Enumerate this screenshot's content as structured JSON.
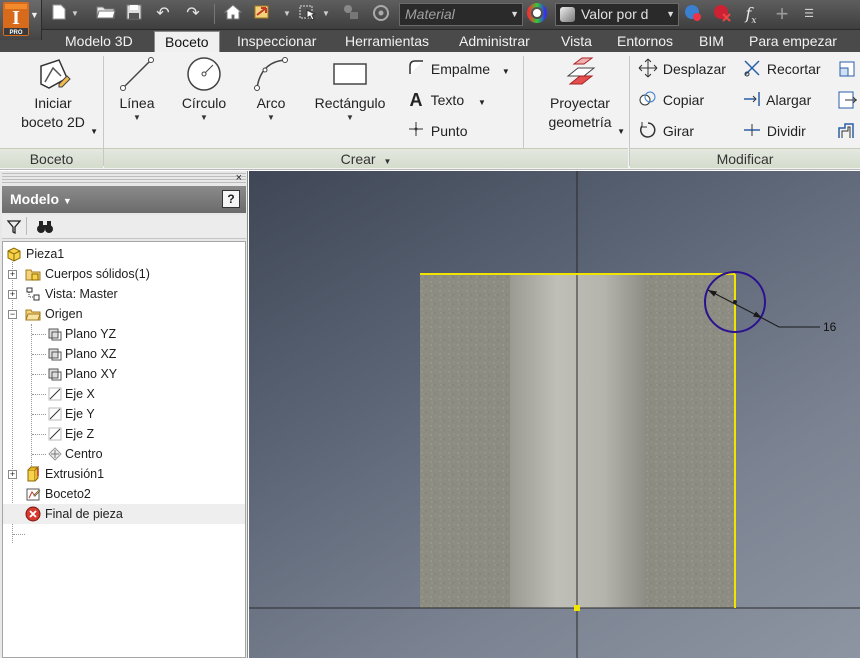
{
  "quick_access": {
    "app_logo_letter": "I",
    "app_edition": "PRO",
    "material_placeholder": "Material",
    "appearance_value": "Valor por d",
    "function_symbol": "f"
  },
  "tabs": [
    {
      "label": "Modelo 3D",
      "active": false
    },
    {
      "label": "Boceto",
      "active": true
    },
    {
      "label": "Inspeccionar",
      "active": false
    },
    {
      "label": "Herramientas",
      "active": false
    },
    {
      "label": "Administrar",
      "active": false
    },
    {
      "label": "Vista",
      "active": false
    },
    {
      "label": "Entornos",
      "active": false
    },
    {
      "label": "BIM",
      "active": false
    },
    {
      "label": "Para empezar",
      "active": false
    }
  ],
  "ribbon": {
    "boceto_panel": {
      "title": "Boceto",
      "start_sketch_line1": "Iniciar",
      "start_sketch_line2": "boceto 2D"
    },
    "crear_panel": {
      "title": "Crear",
      "line": "Línea",
      "circle": "Círculo",
      "arc": "Arco",
      "rectangle": "Rectángulo",
      "fillet": "Empalme",
      "text": "Texto",
      "point": "Punto",
      "project_line1": "Proyectar",
      "project_line2": "geometría"
    },
    "modificar_panel": {
      "title": "Modificar",
      "move": "Desplazar",
      "copy": "Copiar",
      "rotate": "Girar",
      "trim": "Recortar",
      "extend": "Alargar",
      "split": "Dividir"
    }
  },
  "browser": {
    "title": "Modelo",
    "help": "?",
    "close": "×",
    "tree": {
      "root": "Pieza1",
      "solids": "Cuerpos sólidos(1)",
      "view": "Vista: Master",
      "origin": "Origen",
      "plane_yz": "Plano YZ",
      "plane_xz": "Plano XZ",
      "plane_xy": "Plano XY",
      "axis_x": "Eje X",
      "axis_y": "Eje Y",
      "axis_z": "Eje Z",
      "center": "Centro",
      "extrusion": "Extrusión1",
      "sketch": "Boceto2",
      "end_of_part": "Final de pieza"
    }
  },
  "viewport": {
    "dimension_value": "16",
    "colors": {
      "sketch_line": "#f0e400",
      "circle": "#2a1290",
      "material": "#8c8c82",
      "bore": "#b4b4ac"
    }
  }
}
